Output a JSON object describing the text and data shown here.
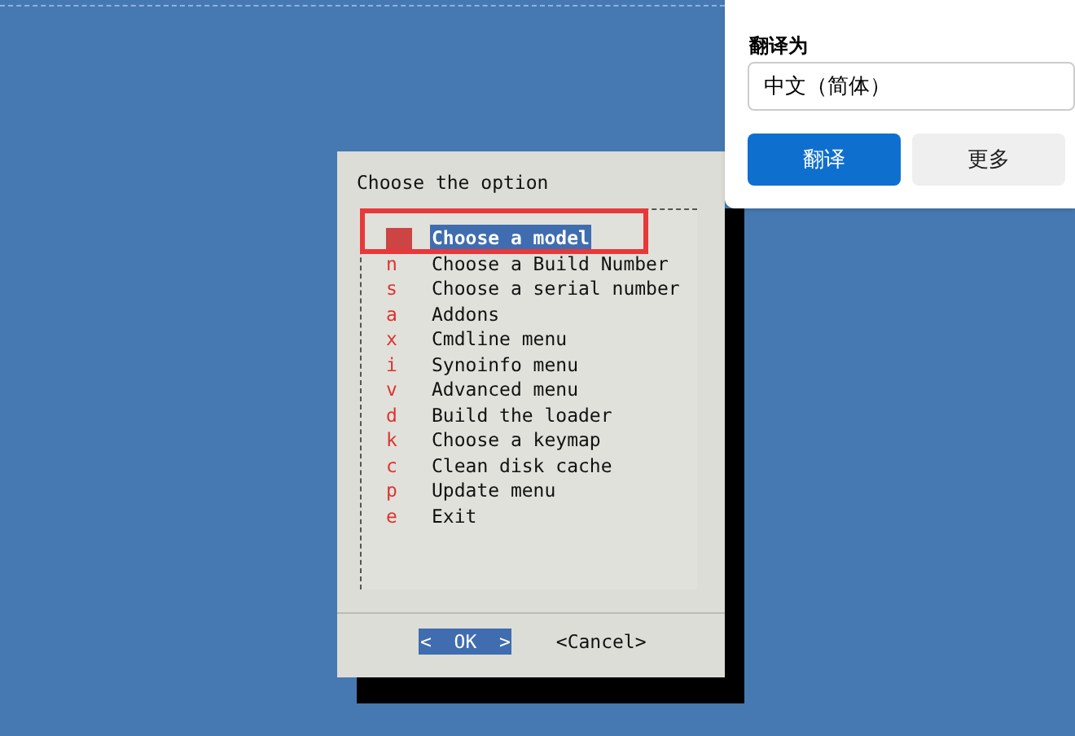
{
  "dialog": {
    "title": "Choose the option",
    "items": [
      {
        "label": "Choose a model",
        "selected": true
      },
      {
        "key": "n",
        "label": "Choose a Build Number",
        "selected": false
      },
      {
        "key": "s",
        "label": "Choose a serial number",
        "selected": false
      },
      {
        "key": "a",
        "label": "Addons",
        "selected": false
      },
      {
        "key": "x",
        "label": "Cmdline menu",
        "selected": false
      },
      {
        "key": "i",
        "label": "Synoinfo menu",
        "selected": false
      },
      {
        "key": "v",
        "label": "Advanced menu",
        "selected": false
      },
      {
        "key": "d",
        "label": "Build the loader",
        "selected": false
      },
      {
        "key": "k",
        "label": "Choose a keymap",
        "selected": false
      },
      {
        "key": "c",
        "label": "Clean disk cache",
        "selected": false
      },
      {
        "key": "p",
        "label": "Update menu",
        "selected": false
      },
      {
        "key": "e",
        "label": "Exit",
        "selected": false
      }
    ],
    "buttons": [
      {
        "open": "<",
        "label": "OK",
        "close": ">",
        "selected": true
      },
      {
        "open": "<",
        "label": "Cancel",
        "close": ">",
        "selected": false
      }
    ]
  },
  "translate_popup": {
    "label": "翻译为",
    "language": "中文（简体）",
    "buttons": [
      {
        "label": "翻译",
        "kind": "primary"
      },
      {
        "label": "更多",
        "kind": "secondary"
      }
    ]
  }
}
